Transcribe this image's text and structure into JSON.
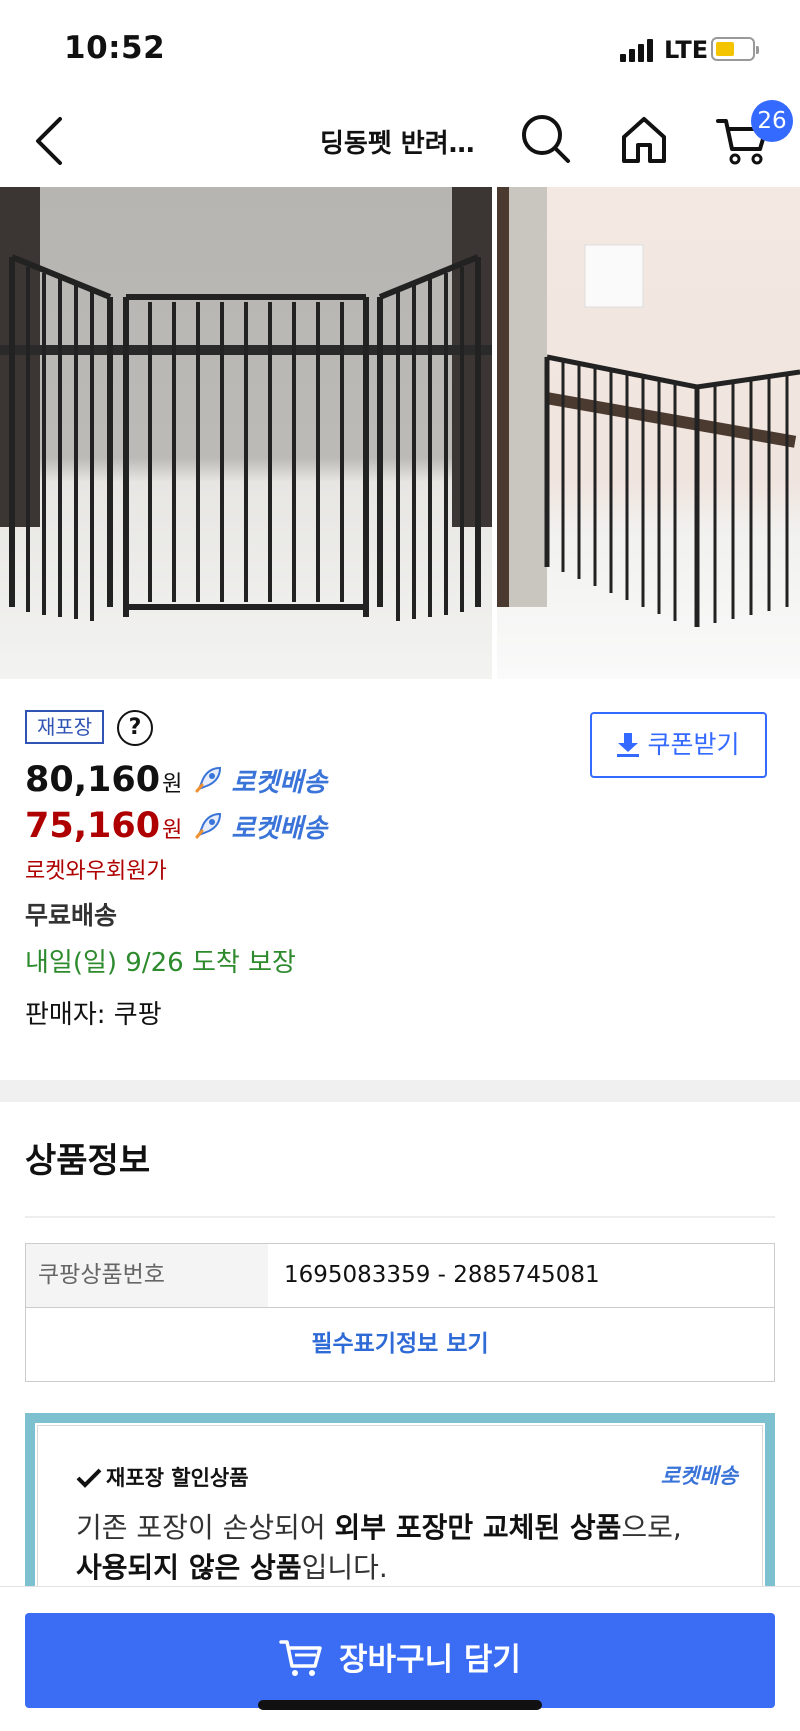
{
  "status": {
    "time": "10:52",
    "network": "LTE"
  },
  "nav": {
    "title": "딩동펫 반려…",
    "cart_count": "26"
  },
  "product": {
    "repack_badge": "재포장",
    "help_icon": "?",
    "coupon_label": "쿠폰받기",
    "price": "80,160",
    "member_price": "75,160",
    "currency": "원",
    "rocket_label": "로켓배송",
    "member_label": "로켓와우회원가",
    "shipping": "무료배송",
    "arrival": "내일(일) 9/26 도착 보장",
    "seller": "판매자: 쿠팡"
  },
  "info": {
    "section_title": "상품정보",
    "product_no_label": "쿠팡상품번호",
    "product_no_value": "1695083359 - 2885745081",
    "required_info_link": "필수표기정보 보기"
  },
  "notice": {
    "tag": "재포장 할인상품",
    "rocket": "로켓배송",
    "line1_a": "기존 포장이 손상되어 ",
    "line1_b": "외부 포장만 교체된 상품",
    "line1_c": "으로,",
    "line2_a": "사용되지 않은 상품",
    "line2_b": "입니다."
  },
  "cta": {
    "label": "장바구니 담기"
  },
  "colors": {
    "accent": "#346aff",
    "member_price": "#ae0000",
    "arrival": "#2d8a2d",
    "rocket": "#3a74d9"
  }
}
